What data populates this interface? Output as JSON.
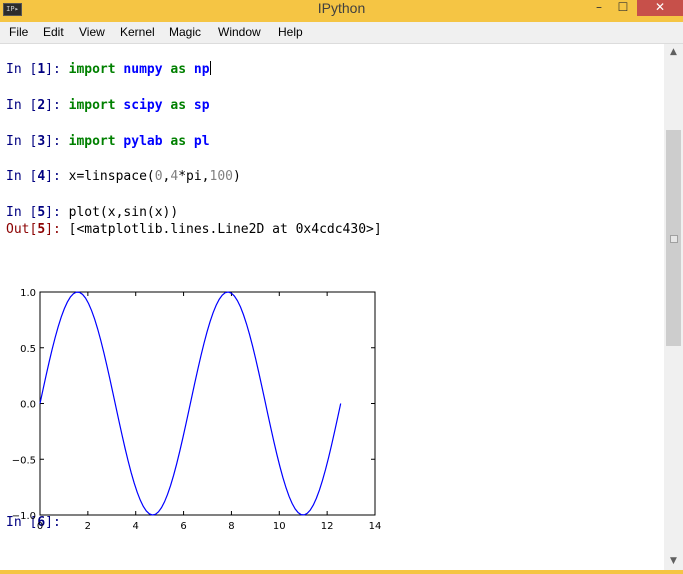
{
  "window": {
    "title": "IPython",
    "icon_text": "IP▸",
    "controls": {
      "minimize": "–",
      "maximize": "☐",
      "close": "✕"
    }
  },
  "menu": [
    "File",
    "Edit",
    "View",
    "Kernel",
    "Magic",
    "Window",
    "Help"
  ],
  "cells": [
    {
      "n": "1",
      "tokens": [
        {
          "t": "import",
          "c": "kw"
        },
        {
          "t": " ",
          "c": "code"
        },
        {
          "t": "numpy",
          "c": "mod"
        },
        {
          "t": " ",
          "c": "code"
        },
        {
          "t": "as",
          "c": "kw"
        },
        {
          "t": " ",
          "c": "code"
        },
        {
          "t": "np",
          "c": "mod"
        }
      ],
      "cursor": true
    },
    {
      "n": "2",
      "tokens": [
        {
          "t": "import",
          "c": "kw"
        },
        {
          "t": " ",
          "c": "code"
        },
        {
          "t": "scipy",
          "c": "mod"
        },
        {
          "t": " ",
          "c": "code"
        },
        {
          "t": "as",
          "c": "kw"
        },
        {
          "t": " ",
          "c": "code"
        },
        {
          "t": "sp",
          "c": "mod"
        }
      ]
    },
    {
      "n": "3",
      "tokens": [
        {
          "t": "import",
          "c": "kw"
        },
        {
          "t": " ",
          "c": "code"
        },
        {
          "t": "pylab",
          "c": "mod"
        },
        {
          "t": " ",
          "c": "code"
        },
        {
          "t": "as",
          "c": "kw"
        },
        {
          "t": " ",
          "c": "code"
        },
        {
          "t": "pl",
          "c": "mod"
        }
      ]
    },
    {
      "n": "4",
      "tokens": [
        {
          "t": "x=linspace(",
          "c": "code"
        },
        {
          "t": "0",
          "c": "num"
        },
        {
          "t": ",",
          "c": "code"
        },
        {
          "t": "4",
          "c": "num"
        },
        {
          "t": "*pi,",
          "c": "code"
        },
        {
          "t": "100",
          "c": "num"
        },
        {
          "t": ")",
          "c": "code"
        }
      ]
    },
    {
      "n": "5",
      "tokens": [
        {
          "t": "plot(x,sin(x))",
          "c": "code"
        }
      ],
      "output": "[<matplotlib.lines.Line2D at 0x4cdc430>]"
    },
    {
      "n": "6",
      "tokens": []
    }
  ],
  "prompt_labels": {
    "in": "In",
    "out": "Out"
  },
  "chart_data": {
    "type": "line",
    "title": "",
    "xlabel": "",
    "ylabel": "",
    "xlim": [
      0,
      14
    ],
    "ylim": [
      -1.0,
      1.0
    ],
    "xticks": [
      "0",
      "2",
      "4",
      "6",
      "8",
      "10",
      "12",
      "14"
    ],
    "yticks": [
      "1.0",
      "0.5",
      "0.0",
      "−0.5",
      "−1.0"
    ],
    "grid": false,
    "color": "#0000ff",
    "series": [
      {
        "x_range": [
          0,
          12.566
        ],
        "points": 100,
        "function": "sin(x)"
      }
    ]
  }
}
